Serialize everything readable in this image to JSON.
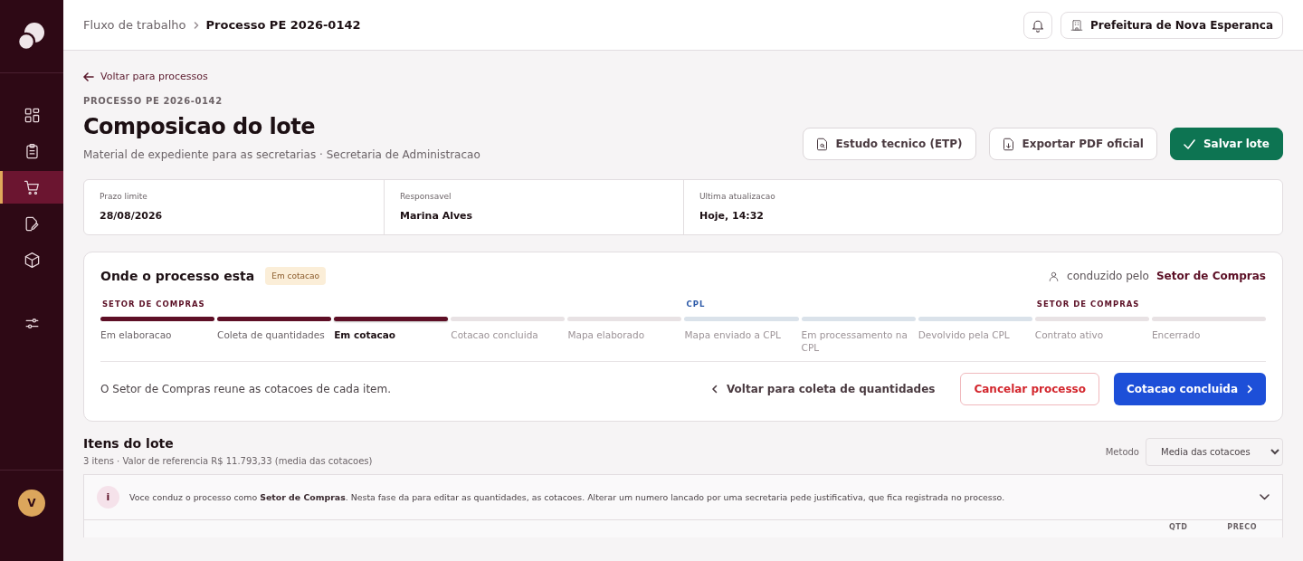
{
  "sidebar": {
    "nav": [
      {
        "selected": false
      },
      {
        "selected": false
      },
      {
        "selected": true
      },
      {
        "selected": false
      },
      {
        "selected": false
      },
      {
        "selected": false
      }
    ],
    "avatar": "V"
  },
  "header": {
    "breadcrumb": [
      "Fluxo de trabalho",
      "Processo PE 2026-0142"
    ],
    "organization": "Prefeitura de Nova Esperanca"
  },
  "back_link": "Voltar para processos",
  "eyebrow": "PROCESSO PE 2026-0142",
  "title": "Composicao do lote",
  "subtitle": "Material de expediente para as secretarias · Secretaria de Administracao",
  "actions": [
    {
      "label": "Estudo tecnico (ETP)",
      "kind": "etp"
    },
    {
      "label": "Exportar PDF oficial",
      "kind": "pdf"
    },
    {
      "label": "Salvar lote",
      "kind": "primary"
    }
  ],
  "info": [
    {
      "label": "Prazo limite",
      "value": "28/08/2026"
    },
    {
      "label": "Responsavel",
      "value": "Marina Alves"
    },
    {
      "label": "Ultima atualizacao",
      "value": "Hoje, 14:32"
    }
  ],
  "progress": {
    "title": "Onde o processo esta",
    "badge": "Em cotacao",
    "led_prefix": "conduzido pelo",
    "led_by": "Setor de Compras",
    "steps": [
      {
        "label": "Em elaboracao",
        "completed": true,
        "selected": false,
        "kind": "compras",
        "group_label": "SETOR DE COMPRAS"
      },
      {
        "label": "Coleta de quantidades",
        "completed": true,
        "selected": false,
        "kind": "compras"
      },
      {
        "label": "Em cotacao",
        "completed": true,
        "selected": true,
        "kind": "compras"
      },
      {
        "label": "Cotacao concluida",
        "completed": false,
        "selected": false,
        "kind": "compras"
      },
      {
        "label": "Mapa elaborado",
        "completed": false,
        "selected": false,
        "kind": "compras"
      },
      {
        "label": "Mapa enviado a CPL",
        "completed": false,
        "selected": false,
        "kind": "cpl",
        "group_label": "CPL"
      },
      {
        "label": "Em processamento na CPL",
        "completed": false,
        "selected": false,
        "kind": "cpl"
      },
      {
        "label": "Devolvido pela CPL",
        "completed": false,
        "selected": false,
        "kind": "cpl"
      },
      {
        "label": "Contrato ativo",
        "completed": false,
        "selected": false,
        "kind": "compras",
        "group_label": "SETOR DE COMPRAS"
      },
      {
        "label": "Encerrado",
        "completed": false,
        "selected": false,
        "kind": "compras"
      }
    ],
    "description": "O Setor de Compras reune as cotacoes de cada item.",
    "back_action": "Voltar para coleta de quantidades",
    "cancel_action": "Cancelar processo",
    "next_action": "Cotacao concluida"
  },
  "items": {
    "title": "Itens do lote",
    "summary": "3 itens · Valor de referencia R$ 11.793,33 (media das cotacoes)",
    "method_label": "Metodo",
    "method_value": "Media das cotacoes",
    "notice": "Voce conduz o processo como **Setor de Compras**. Nesta fase da para editar as quantidades, as cotacoes. Alterar um numero lancado por uma secretaria pede justificativa, que fica registrada no processo.",
    "notice_icon": "i",
    "columns": [
      "QTD",
      "PRECO"
    ]
  }
}
